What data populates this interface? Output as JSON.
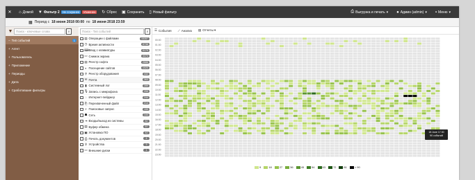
{
  "topbar": {
    "close_icon": "close-icon",
    "home": "Домой",
    "filter": "Фильтр 2",
    "not_saved": "Не сохранен",
    "changed": "Изменен",
    "reset": "Сброс",
    "save": "Сохранить",
    "new_filter": "Новый фильтр",
    "export": "Выгрузка и печать",
    "admin": "Админ (admin)",
    "menu": "Меню"
  },
  "period": {
    "prefix": "Период с",
    "from": "18 июня 2018 00:00",
    "to_word": "по",
    "to": "18 июня 2018 23:59"
  },
  "left": {
    "search_placeholder": "Поиск - ключевые слова",
    "items": [
      {
        "label": "Тип событий",
        "count": "1",
        "active": true
      },
      {
        "label": "Агент",
        "count": "",
        "active": false
      },
      {
        "label": "Пользователь",
        "count": "",
        "active": false
      },
      {
        "label": "Приложение",
        "count": "",
        "active": false
      },
      {
        "label": "Периоды",
        "count": "",
        "active": false
      },
      {
        "label": "Дата",
        "count": "",
        "active": false
      },
      {
        "label": "Сработавшие фильтры",
        "count": "",
        "active": false
      }
    ]
  },
  "middle": {
    "search_placeholder": "Поиск - Тип событий",
    "items": [
      {
        "label": "Операции с файлами",
        "count": "15357",
        "icon": "▤",
        "checked": false
      },
      {
        "label": "Время активности",
        "count": "5738",
        "icon": "◷",
        "checked": false
      },
      {
        "label": "Ввод с клавиатуры",
        "count": "5179",
        "icon": "⌨",
        "checked": false
      },
      {
        "label": "Снимок экрана",
        "count": "3373",
        "icon": "▭",
        "checked": false
      },
      {
        "label": "Реестр софта",
        "count": "2686",
        "icon": "▤",
        "checked": false
      },
      {
        "label": "Посещение сайтов",
        "count": "1020",
        "icon": "◐",
        "checked": false
      },
      {
        "label": "Реестр оборудования",
        "count": "432",
        "icon": "⚲",
        "checked": false
      },
      {
        "label": "Почта",
        "count": "363",
        "icon": "✉",
        "checked": true
      },
      {
        "label": "Системный лог",
        "count": "289",
        "icon": "▮",
        "checked": false
      },
      {
        "label": "Запись с микрофона",
        "count": "255",
        "icon": "🎙",
        "checked": false
      },
      {
        "label": "Интернет-пейджер",
        "count": "244",
        "icon": "◌",
        "checked": false
      },
      {
        "label": "Перехваченный файл",
        "count": "214",
        "icon": "⎘",
        "checked": false
      },
      {
        "label": "Поисковые запрос",
        "count": "155",
        "icon": "⌕",
        "checked": false
      },
      {
        "label": "Сеть",
        "count": "144",
        "icon": "☗",
        "checked": false
      },
      {
        "label": "Входы/выход из системы",
        "count": "82",
        "icon": "⇥",
        "checked": false
      },
      {
        "label": "Буфер обмена",
        "count": "57",
        "icon": "▤",
        "checked": false
      },
      {
        "label": "Установка ПО",
        "count": "42",
        "icon": "▣",
        "checked": false
      },
      {
        "label": "Печать документов",
        "count": "4",
        "icon": "⎙",
        "checked": false
      },
      {
        "label": "Устройства",
        "count": "3",
        "icon": "⚲",
        "checked": false
      },
      {
        "label": "Внешние диски",
        "count": "1",
        "icon": "▭",
        "checked": false
      }
    ]
  },
  "right": {
    "tabs": [
      {
        "label": "События",
        "icon": "list-icon"
      },
      {
        "label": "Анализ",
        "icon": "chart-icon"
      },
      {
        "label": "Отчеты",
        "icon": "report-icon"
      }
    ],
    "tooltip_line1": "18 June 17:30",
    "tooltip_line2": "90 событий"
  },
  "chart_data": {
    "type": "heatmap",
    "rows": [
      "00:00",
      "00:30",
      "01:00",
      "01:30",
      "02:00",
      "02:30",
      "03:00",
      "03:30",
      "04:00",
      "04:30",
      "05:00",
      "05:30",
      "06:00",
      "06:30",
      "07:00",
      "07:30",
      "08:00",
      "08:30",
      "09:00",
      "09:30",
      "10:00",
      "10:30",
      "11:00",
      "11:30",
      "12:00",
      "12:30",
      "13:00",
      "13:30",
      "14:00",
      "14:30",
      "15:00",
      "15:30",
      "16:00",
      "16:30",
      "17:00",
      "17:30",
      "18:00",
      "18:30",
      "19:00",
      "19:30",
      "20:00",
      "20:30",
      "21:00",
      "21:30",
      "22:00",
      "22:30",
      "23:00",
      "23:30"
    ],
    "legend": [
      "9",
      "18",
      "27",
      "36",
      "45",
      "54",
      "63",
      "72",
      "81",
      "> 90"
    ],
    "legend_colors": [
      "#cfe68d",
      "#b5d568",
      "#97c24d",
      "#79ad3d",
      "#5c9632",
      "#3f7e27",
      "#2c6a1e",
      "#1e5515",
      "#123d0d",
      "#000000"
    ],
    "empty_color": "#e4e4e4"
  }
}
